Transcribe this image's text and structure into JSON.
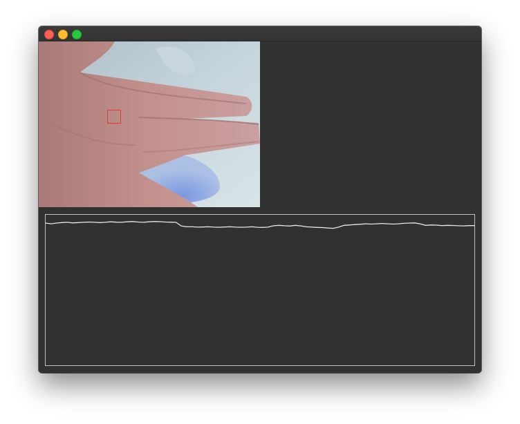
{
  "window": {
    "title": ""
  },
  "camera_view": {
    "description_icon": "camera-feed",
    "roi_color": "#e23b3b"
  },
  "signal_plot": {
    "line_color": "#e8e8e8",
    "frame_color": "#bdbdbd"
  },
  "chart_data": {
    "type": "line",
    "series": [
      {
        "values": [
          0.945,
          0.94,
          0.945,
          0.948,
          0.95,
          0.946,
          0.948,
          0.95,
          0.952,
          0.95,
          0.948,
          0.95,
          0.953,
          0.951,
          0.95,
          0.953,
          0.955,
          0.952,
          0.95,
          0.953,
          0.955,
          0.954,
          0.952,
          0.951,
          0.95,
          0.925,
          0.92,
          0.92,
          0.918,
          0.919,
          0.92,
          0.918,
          0.917,
          0.919,
          0.92,
          0.918,
          0.917,
          0.918,
          0.92,
          0.917,
          0.916,
          0.918,
          0.927,
          0.93,
          0.927,
          0.925,
          0.93,
          0.926,
          0.92,
          0.918,
          0.916,
          0.915,
          0.912,
          0.91,
          0.918,
          0.93,
          0.932,
          0.935,
          0.937,
          0.94,
          0.938,
          0.94,
          0.942,
          0.94,
          0.938,
          0.94,
          0.943,
          0.945,
          0.946,
          0.94,
          0.93,
          0.932,
          0.931,
          0.928,
          0.93,
          0.929,
          0.927,
          0.926,
          0.928,
          0.928
        ],
        "color": "#e8e8e8"
      }
    ],
    "ylim": [
      0,
      1
    ],
    "grid": false,
    "legend": "none"
  }
}
